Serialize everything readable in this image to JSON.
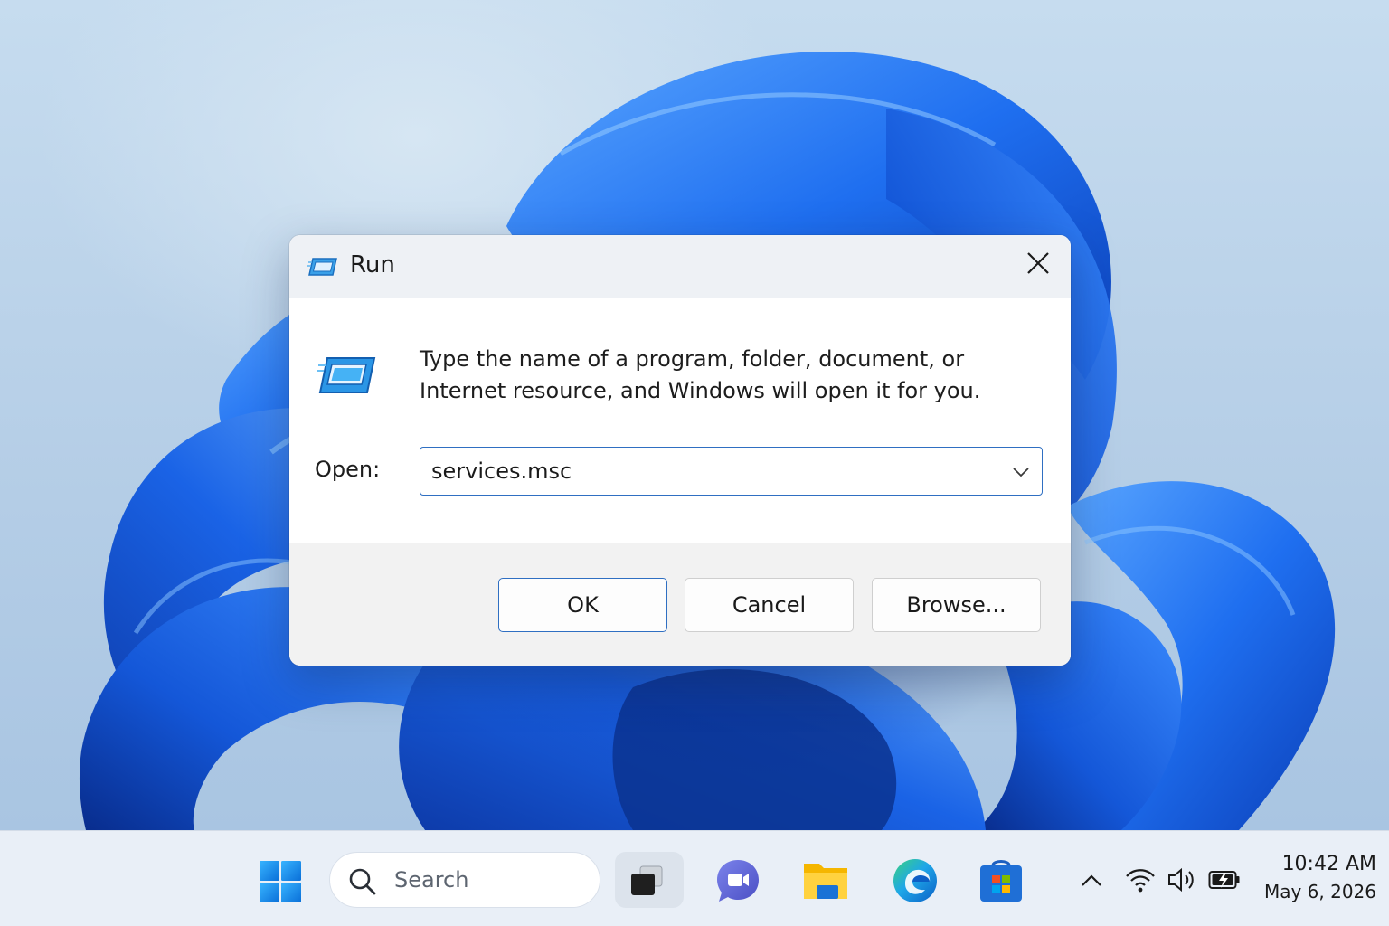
{
  "dialog": {
    "title": "Run",
    "description": "Type the name of a program, folder, document, or Internet resource, and Windows will open it for you.",
    "open_label": "Open:",
    "input_value": "services.msc",
    "buttons": {
      "ok": "OK",
      "cancel": "Cancel",
      "browse": "Browse..."
    }
  },
  "taskbar": {
    "search_placeholder": "Search",
    "pinned_apps": [
      "task-view",
      "teams",
      "file-explorer",
      "edge",
      "microsoft-store"
    ],
    "tray_icons": [
      "chevron-up-icon",
      "wifi-icon",
      "volume-icon",
      "battery-icon"
    ],
    "time": "10:42 AM",
    "date": "May 6, 2026"
  },
  "colors": {
    "accent": "#2f6fc2",
    "wallpaper_bloom": "#1f6ff0",
    "wallpaper_bg": "#b8d2ea",
    "taskbar_bg": "#e9eff7"
  }
}
